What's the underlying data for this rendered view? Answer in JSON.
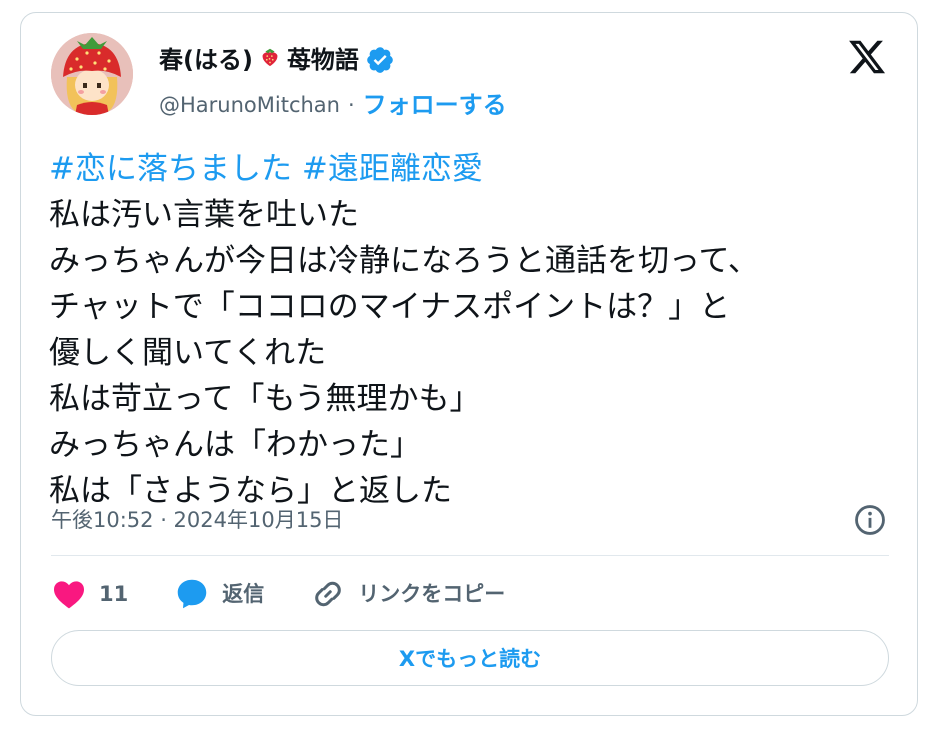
{
  "user": {
    "name": "春(はる)",
    "name_suffix": "苺物語",
    "handle": "@HarunoMitchan",
    "separator": "·",
    "follow_label": "フォローする",
    "avatar_icon": "strawberry-hat-girl-avatar",
    "emoji_icon": "strawberry-icon",
    "verified_icon": "verified-badge-icon"
  },
  "tweet": {
    "hashtags": [
      "#恋に落ちました",
      "#遠距離恋愛"
    ],
    "lines": [
      "私は汚い言葉を吐いた",
      "みっちゃんが今日は冷静になろうと通話を切って、",
      "チャットで「ココロのマイナスポイントは？」と",
      "優しく聞いてくれた",
      "私は苛立って「もう無理かも」",
      "みっちゃんは「わかった」",
      "私は「さようなら」と返した"
    ],
    "timestamp": "午後10:52 · 2024年10月15日"
  },
  "actions": {
    "like_count": "11",
    "reply_label": "返信",
    "copy_link_label": "リンクをコピー"
  },
  "read_more_label": "Xでもっと読む",
  "colors": {
    "accent": "#1d9bf0",
    "like": "#f91880",
    "text": "#0f1419",
    "muted": "#536471",
    "border": "#cfd9de"
  }
}
